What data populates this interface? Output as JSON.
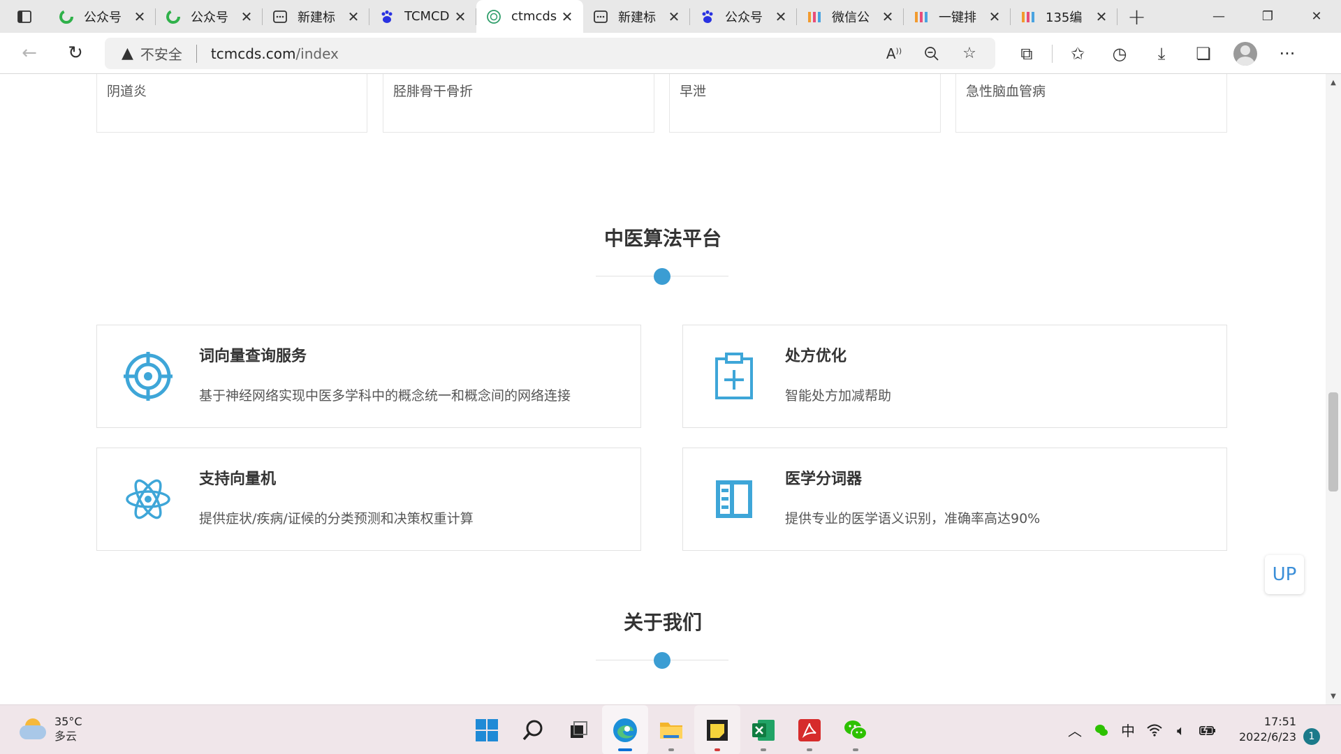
{
  "browser": {
    "tabs": [
      {
        "title": "公众号",
        "icon": "green-swirl-icon"
      },
      {
        "title": "公众号",
        "icon": "green-swirl-icon"
      },
      {
        "title": "新建标",
        "icon": "new-tab-page-icon"
      },
      {
        "title": "TCMCD",
        "icon": "baidu-paw-icon"
      },
      {
        "title": "ctmcds",
        "icon": "ctmcds-logo-icon",
        "active": true
      },
      {
        "title": "新建标",
        "icon": "new-tab-page-icon"
      },
      {
        "title": "公众号",
        "icon": "baidu-paw-icon"
      },
      {
        "title": "微信公",
        "icon": "135-editor-icon"
      },
      {
        "title": "一键排",
        "icon": "135-editor-icon"
      },
      {
        "title": "135编",
        "icon": "135-editor-icon"
      }
    ],
    "address": {
      "security_label": "不安全",
      "host": "tcmcds.com",
      "path": "/index"
    }
  },
  "page": {
    "disease_cards": [
      "阴道炎",
      "胫腓骨干骨折",
      "早泄",
      "急性脑血管病"
    ],
    "algorithm_section": {
      "title": "中医算法平台",
      "features": [
        {
          "title": "词向量查询服务",
          "desc": "基于神经网络实现中医多学科中的概念统一和概念间的网络连接",
          "icon": "target-crosshair-icon"
        },
        {
          "title": "处方优化",
          "desc": "智能处方加减帮助",
          "icon": "clipboard-plus-icon"
        },
        {
          "title": "支持向量机",
          "desc": "提供症状/疾病/证候的分类预测和决策权重计算",
          "icon": "atom-icon"
        },
        {
          "title": "医学分词器",
          "desc": "提供专业的医学语义识别，准确率高达90%",
          "icon": "book-columns-icon"
        }
      ]
    },
    "about_section": {
      "title": "关于我们"
    },
    "up_button": "UP"
  },
  "taskbar": {
    "weather": {
      "temp": "35°C",
      "condition": "多云"
    },
    "ime": "中",
    "time": "17:51",
    "date": "2022/6/23",
    "notification_count": "1"
  },
  "colors": {
    "accent": "#3b9dd3",
    "icon_blue": "#3ea6d8",
    "up_text": "#3a8ed8"
  }
}
